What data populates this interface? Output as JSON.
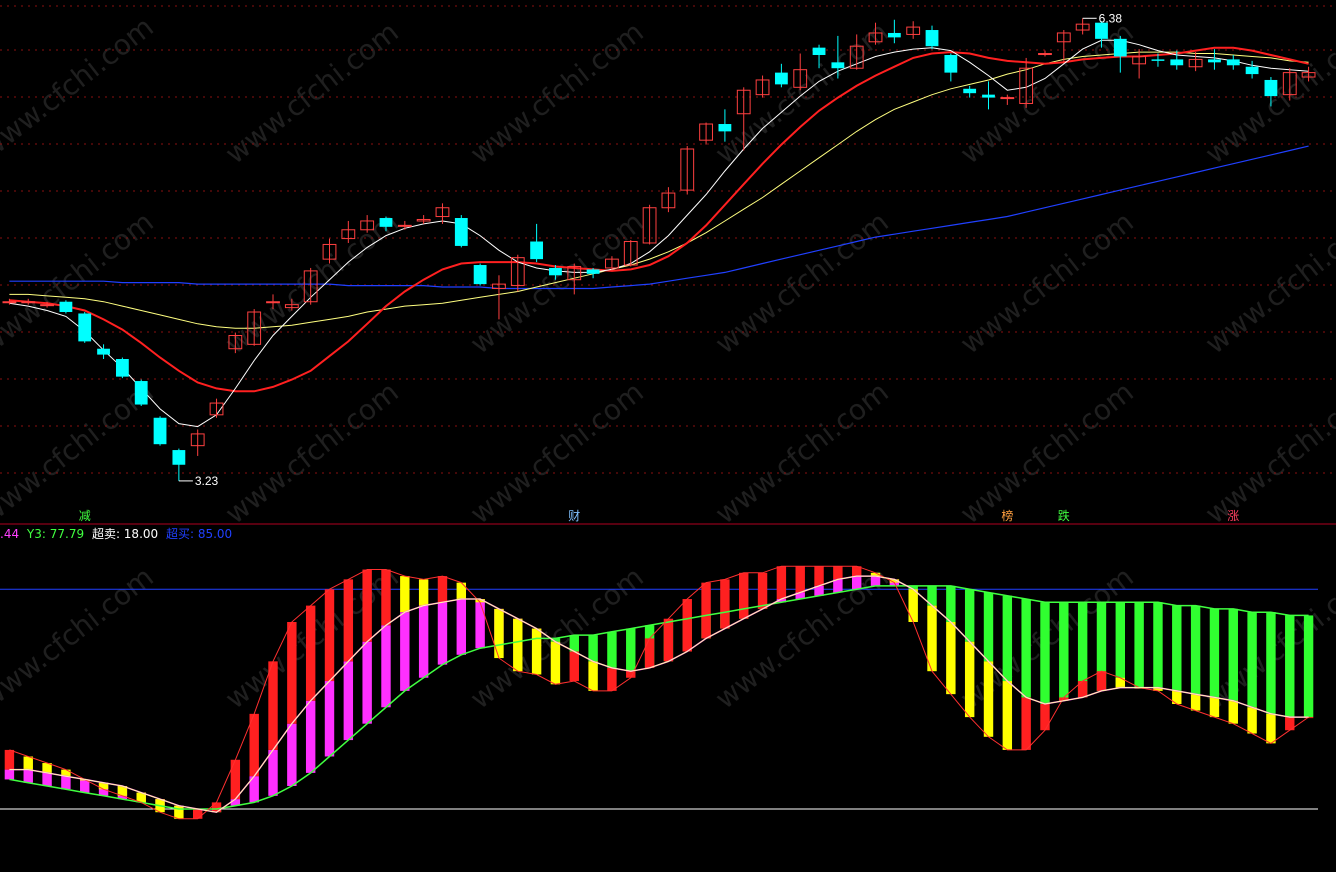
{
  "colors": {
    "background": "#000000",
    "bull": "#ff4040",
    "bear": "#00ffff",
    "ma_white": "#ffffff",
    "ma_red": "#ff2020",
    "ma_yellow": "#ffff80",
    "ma_blue": "#2040ff",
    "grid": "#8a1010",
    "separator": "#b00020"
  },
  "watermark": "www.cfchi.com",
  "price_chart": {
    "high_label": "6.38",
    "low_label": "3.23",
    "bottom_markers": [
      {
        "text": "减",
        "color": "#40ff40",
        "index": 4
      },
      {
        "text": "财",
        "color": "#80c0ff",
        "index": 30
      },
      {
        "text": "榜",
        "color": "#ffa040",
        "index": 53
      },
      {
        "text": "跌",
        "color": "#40ff40",
        "index": 56
      },
      {
        "text": "涨",
        "color": "#ff4060",
        "index": 65
      }
    ]
  },
  "indicator": {
    "legend": [
      {
        "text": ".44",
        "color": "#ff40ff"
      },
      {
        "text": "Y3: 77.79",
        "color": "#40ff40"
      },
      {
        "text": "超卖: 18.00",
        "color": "#ffffff"
      },
      {
        "text": "超买: 85.00",
        "color": "#2040ff"
      }
    ],
    "overbought": 85,
    "oversold": 18
  },
  "chart_data": {
    "type": "candlestick",
    "candles": [
      {
        "o": 4.45,
        "c": 4.45,
        "h": 4.47,
        "l": 4.43
      },
      {
        "o": 4.45,
        "c": 4.45,
        "h": 4.47,
        "l": 4.43
      },
      {
        "o": 4.43,
        "c": 4.43,
        "h": 4.45,
        "l": 4.41
      },
      {
        "o": 4.45,
        "c": 4.38,
        "h": 4.46,
        "l": 4.37
      },
      {
        "o": 4.37,
        "c": 4.18,
        "h": 4.38,
        "l": 4.17
      },
      {
        "o": 4.13,
        "c": 4.09,
        "h": 4.16,
        "l": 4.06
      },
      {
        "o": 4.06,
        "c": 3.94,
        "h": 4.07,
        "l": 3.93
      },
      {
        "o": 3.91,
        "c": 3.75,
        "h": 3.92,
        "l": 3.74
      },
      {
        "o": 3.66,
        "c": 3.48,
        "h": 3.67,
        "l": 3.47
      },
      {
        "o": 3.44,
        "c": 3.34,
        "h": 3.45,
        "l": 3.23
      },
      {
        "o": 3.47,
        "c": 3.55,
        "h": 3.58,
        "l": 3.4
      },
      {
        "o": 3.68,
        "c": 3.76,
        "h": 3.79,
        "l": 3.66
      },
      {
        "o": 4.13,
        "c": 4.22,
        "h": 4.24,
        "l": 4.1
      },
      {
        "o": 4.16,
        "c": 4.38,
        "h": 4.4,
        "l": 4.15
      },
      {
        "o": 4.45,
        "c": 4.45,
        "h": 4.5,
        "l": 4.4
      },
      {
        "o": 4.41,
        "c": 4.43,
        "h": 4.47,
        "l": 4.39
      },
      {
        "o": 4.45,
        "c": 4.66,
        "h": 4.68,
        "l": 4.43
      },
      {
        "o": 4.74,
        "c": 4.84,
        "h": 4.88,
        "l": 4.71
      },
      {
        "o": 4.88,
        "c": 4.94,
        "h": 5.0,
        "l": 4.85
      },
      {
        "o": 4.94,
        "c": 5.0,
        "h": 5.04,
        "l": 4.92
      },
      {
        "o": 5.02,
        "c": 4.96,
        "h": 5.03,
        "l": 4.93
      },
      {
        "o": 4.97,
        "c": 4.97,
        "h": 5.0,
        "l": 4.94
      },
      {
        "o": 5.0,
        "c": 5.01,
        "h": 5.04,
        "l": 4.98
      },
      {
        "o": 5.03,
        "c": 5.09,
        "h": 5.12,
        "l": 4.98
      },
      {
        "o": 5.02,
        "c": 4.83,
        "h": 5.04,
        "l": 4.82
      },
      {
        "o": 4.7,
        "c": 4.57,
        "h": 4.71,
        "l": 4.56
      },
      {
        "o": 4.54,
        "c": 4.57,
        "h": 4.63,
        "l": 4.33
      },
      {
        "o": 4.56,
        "c": 4.75,
        "h": 4.77,
        "l": 4.52
      },
      {
        "o": 4.86,
        "c": 4.74,
        "h": 4.98,
        "l": 4.72
      },
      {
        "o": 4.68,
        "c": 4.63,
        "h": 4.7,
        "l": 4.6
      },
      {
        "o": 4.6,
        "c": 4.69,
        "h": 4.71,
        "l": 4.5
      },
      {
        "o": 4.67,
        "c": 4.64,
        "h": 4.68,
        "l": 4.61
      },
      {
        "o": 4.68,
        "c": 4.74,
        "h": 4.76,
        "l": 4.66
      },
      {
        "o": 4.7,
        "c": 4.86,
        "h": 4.87,
        "l": 4.69
      },
      {
        "o": 4.85,
        "c": 5.09,
        "h": 5.11,
        "l": 4.84
      },
      {
        "o": 5.09,
        "c": 5.19,
        "h": 5.23,
        "l": 5.06
      },
      {
        "o": 5.21,
        "c": 5.49,
        "h": 5.51,
        "l": 5.18
      },
      {
        "o": 5.55,
        "c": 5.66,
        "h": 5.67,
        "l": 5.52
      },
      {
        "o": 5.66,
        "c": 5.61,
        "h": 5.76,
        "l": 5.54
      },
      {
        "o": 5.73,
        "c": 5.89,
        "h": 5.91,
        "l": 5.48
      },
      {
        "o": 5.86,
        "c": 5.96,
        "h": 5.99,
        "l": 5.84
      },
      {
        "o": 6.01,
        "c": 5.93,
        "h": 6.07,
        "l": 5.91
      },
      {
        "o": 5.91,
        "c": 6.03,
        "h": 6.14,
        "l": 5.89
      },
      {
        "o": 6.18,
        "c": 6.13,
        "h": 6.2,
        "l": 6.04
      },
      {
        "o": 6.08,
        "c": 6.04,
        "h": 6.26,
        "l": 5.97
      },
      {
        "o": 6.04,
        "c": 6.19,
        "h": 6.27,
        "l": 6.03
      },
      {
        "o": 6.22,
        "c": 6.28,
        "h": 6.35,
        "l": 6.2
      },
      {
        "o": 6.28,
        "c": 6.25,
        "h": 6.37,
        "l": 6.21
      },
      {
        "o": 6.27,
        "c": 6.32,
        "h": 6.36,
        "l": 6.24
      },
      {
        "o": 6.3,
        "c": 6.19,
        "h": 6.33,
        "l": 6.17
      },
      {
        "o": 6.13,
        "c": 6.01,
        "h": 6.14,
        "l": 5.95
      },
      {
        "o": 5.9,
        "c": 5.87,
        "h": 5.92,
        "l": 5.84
      },
      {
        "o": 5.86,
        "c": 5.84,
        "h": 5.95,
        "l": 5.76
      },
      {
        "o": 5.84,
        "c": 5.84,
        "h": 5.86,
        "l": 5.79
      },
      {
        "o": 5.8,
        "c": 6.04,
        "h": 6.11,
        "l": 5.77
      },
      {
        "o": 6.14,
        "c": 6.14,
        "h": 6.16,
        "l": 6.12
      },
      {
        "o": 6.22,
        "c": 6.28,
        "h": 6.3,
        "l": 6.08
      },
      {
        "o": 6.3,
        "c": 6.34,
        "h": 6.38,
        "l": 6.27
      },
      {
        "o": 6.35,
        "c": 6.24,
        "h": 6.36,
        "l": 6.18
      },
      {
        "o": 6.24,
        "c": 6.12,
        "h": 6.26,
        "l": 6.01
      },
      {
        "o": 6.07,
        "c": 6.12,
        "h": 6.17,
        "l": 5.97
      },
      {
        "o": 6.1,
        "c": 6.09,
        "h": 6.14,
        "l": 6.05
      },
      {
        "o": 6.1,
        "c": 6.06,
        "h": 6.16,
        "l": 6.03
      },
      {
        "o": 6.05,
        "c": 6.1,
        "h": 6.15,
        "l": 6.02
      },
      {
        "o": 6.1,
        "c": 6.08,
        "h": 6.17,
        "l": 6.03
      },
      {
        "o": 6.1,
        "c": 6.06,
        "h": 6.13,
        "l": 6.03
      },
      {
        "o": 6.05,
        "c": 6.0,
        "h": 6.09,
        "l": 5.97
      },
      {
        "o": 5.96,
        "c": 5.85,
        "h": 5.98,
        "l": 5.78
      },
      {
        "o": 5.86,
        "c": 6.01,
        "h": 6.04,
        "l": 5.82
      },
      {
        "o": 5.98,
        "c": 6.01,
        "h": 6.05,
        "l": 5.95
      }
    ],
    "ma_white": [
      4.44,
      4.42,
      4.39,
      4.35,
      4.25,
      4.12,
      4.0,
      3.86,
      3.72,
      3.62,
      3.6,
      3.68,
      3.86,
      4.05,
      4.22,
      4.35,
      4.48,
      4.6,
      4.72,
      4.82,
      4.9,
      4.95,
      4.98,
      5.0,
      4.98,
      4.9,
      4.8,
      4.72,
      4.68,
      4.66,
      4.65,
      4.65,
      4.67,
      4.71,
      4.79,
      4.9,
      5.04,
      5.18,
      5.34,
      5.49,
      5.63,
      5.74,
      5.85,
      5.95,
      6.02,
      6.07,
      6.12,
      6.15,
      6.17,
      6.18,
      6.16,
      6.08,
      5.99,
      5.89,
      5.91,
      5.97,
      6.07,
      6.17,
      6.23,
      6.23,
      6.2,
      6.16,
      6.13,
      6.12,
      6.11,
      6.09,
      6.06,
      6.04,
      6.03,
      6.02
    ],
    "ma_red": [
      4.46,
      4.45,
      4.44,
      4.42,
      4.39,
      4.33,
      4.26,
      4.17,
      4.07,
      3.98,
      3.9,
      3.86,
      3.84,
      3.84,
      3.87,
      3.92,
      3.98,
      4.08,
      4.18,
      4.3,
      4.42,
      4.52,
      4.6,
      4.67,
      4.71,
      4.72,
      4.72,
      4.72,
      4.71,
      4.69,
      4.68,
      4.67,
      4.66,
      4.67,
      4.7,
      4.76,
      4.85,
      4.97,
      5.11,
      5.25,
      5.39,
      5.52,
      5.64,
      5.75,
      5.84,
      5.92,
      5.99,
      6.05,
      6.11,
      6.14,
      6.15,
      6.14,
      6.11,
      6.09,
      6.08,
      6.07,
      6.08,
      6.1,
      6.11,
      6.12,
      6.12,
      6.13,
      6.14,
      6.16,
      6.18,
      6.18,
      6.16,
      6.13,
      6.1,
      6.07
    ],
    "ma_yellow": [
      4.5,
      4.5,
      4.49,
      4.48,
      4.47,
      4.45,
      4.42,
      4.39,
      4.36,
      4.33,
      4.3,
      4.28,
      4.27,
      4.27,
      4.28,
      4.29,
      4.31,
      4.33,
      4.35,
      4.38,
      4.4,
      4.42,
      4.43,
      4.44,
      4.46,
      4.48,
      4.5,
      4.52,
      4.55,
      4.58,
      4.61,
      4.64,
      4.67,
      4.7,
      4.74,
      4.79,
      4.85,
      4.92,
      5.0,
      5.08,
      5.16,
      5.25,
      5.34,
      5.43,
      5.52,
      5.61,
      5.69,
      5.76,
      5.81,
      5.86,
      5.9,
      5.93,
      5.96,
      6.0,
      6.03,
      6.07,
      6.1,
      6.12,
      6.13,
      6.14,
      6.15,
      6.15,
      6.15,
      6.14,
      6.14,
      6.13,
      6.12,
      6.11,
      6.09,
      6.08
    ],
    "ma_blue": [
      4.59,
      4.59,
      4.59,
      4.59,
      4.59,
      4.59,
      4.58,
      4.58,
      4.58,
      4.58,
      4.57,
      4.57,
      4.57,
      4.57,
      4.57,
      4.57,
      4.57,
      4.57,
      4.56,
      4.56,
      4.56,
      4.56,
      4.56,
      4.55,
      4.55,
      4.55,
      4.54,
      4.54,
      4.54,
      4.54,
      4.54,
      4.54,
      4.55,
      4.56,
      4.57,
      4.59,
      4.61,
      4.63,
      4.65,
      4.68,
      4.71,
      4.74,
      4.77,
      4.8,
      4.83,
      4.86,
      4.89,
      4.91,
      4.93,
      4.95,
      4.97,
      4.99,
      5.01,
      5.03,
      5.06,
      5.09,
      5.12,
      5.15,
      5.18,
      5.21,
      5.24,
      5.27,
      5.3,
      5.33,
      5.36,
      5.39,
      5.42,
      5.45,
      5.48,
      5.51
    ],
    "price_range": [
      3.1,
      6.45
    ],
    "indicator_fast": [
      36,
      34,
      32,
      30,
      27,
      24,
      22,
      20,
      17,
      15,
      15,
      20,
      33,
      47,
      63,
      75,
      80,
      85,
      88,
      91,
      91,
      89,
      88,
      89,
      87,
      81,
      64,
      60,
      59,
      56,
      57,
      54,
      54,
      58,
      70,
      76,
      82,
      87,
      88,
      90,
      90,
      92,
      92,
      92,
      92,
      92,
      90,
      87,
      75,
      60,
      53,
      46,
      40,
      36,
      36,
      42,
      52,
      57,
      60,
      58,
      55,
      54,
      50,
      48,
      46,
      44,
      41,
      38,
      42,
      46
    ],
    "indicator_trail": [
      30,
      30,
      29,
      28,
      27,
      26,
      25,
      23,
      21,
      19,
      18,
      17,
      21,
      28,
      36,
      44,
      51,
      57,
      63,
      69,
      74,
      78,
      80,
      81,
      82,
      82,
      79,
      76,
      73,
      69,
      66,
      63,
      61,
      60,
      61,
      63,
      66,
      70,
      73,
      76,
      79,
      82,
      84,
      86,
      88,
      89,
      89,
      88,
      85,
      80,
      75,
      69,
      63,
      57,
      52,
      50,
      51,
      52,
      54,
      55,
      55,
      55,
      54,
      53,
      52,
      51,
      49,
      47,
      46,
      46
    ],
    "indicator_slow": [
      27,
      26,
      25,
      24,
      23,
      22,
      21,
      20,
      19,
      18,
      18,
      18,
      19,
      20,
      22,
      25,
      29,
      34,
      39,
      44,
      49,
      54,
      58,
      62,
      65,
      67,
      68,
      69,
      70,
      70,
      71,
      71,
      72,
      73,
      74,
      75,
      76,
      77,
      78,
      79,
      80,
      81,
      82,
      83,
      84,
      85,
      86,
      86,
      86,
      86,
      86,
      85,
      84,
      83,
      82,
      81,
      81,
      81,
      81,
      81,
      81,
      81,
      80,
      80,
      79,
      79,
      78,
      78,
      77,
      77
    ],
    "indicator_range": [
      0,
      100
    ]
  }
}
